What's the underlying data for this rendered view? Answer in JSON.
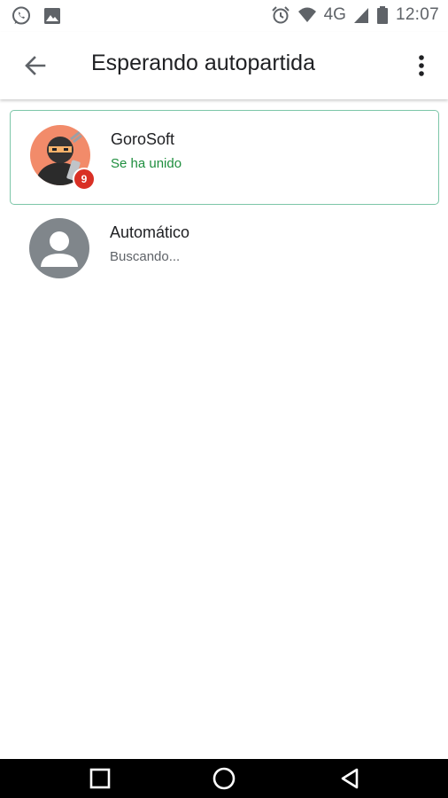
{
  "status_bar": {
    "left_icons": [
      "whatsapp-icon",
      "gallery-icon"
    ],
    "right_icons": [
      "alarm-icon",
      "wifi-icon",
      "signal-icon",
      "battery-icon"
    ],
    "network": "4G",
    "time": "12:07"
  },
  "app_bar": {
    "title": "Esperando autopartida",
    "back_icon": "arrow-back-icon",
    "menu_icon": "more-vert-icon"
  },
  "players": [
    {
      "name": "GoroSoft",
      "status": "Se ha unido",
      "badge": "9",
      "selected": true
    },
    {
      "name": "Automático",
      "status": "Buscando..."
    }
  ],
  "colors": {
    "accent_green": "#1e8e3e",
    "selected_border": "#7cc6a8",
    "badge_red": "#d93025",
    "avatar_orange": "#f28b6a",
    "placeholder_gray": "#80868b"
  },
  "nav_bar": {
    "icons": [
      "recents-square-icon",
      "home-circle-icon",
      "back-triangle-icon"
    ]
  }
}
